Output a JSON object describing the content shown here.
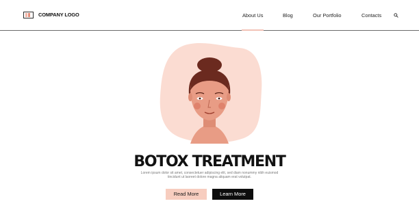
{
  "header": {
    "logo_text": "COMPANY LOGO",
    "nav": [
      {
        "label": "About Us",
        "active": true
      },
      {
        "label": "Blog"
      },
      {
        "label": "Our Portfolio"
      },
      {
        "label": "Contacts"
      }
    ],
    "search_icon": "search-icon"
  },
  "hero": {
    "title": "BOTOX TREATMENT",
    "description": "Lorem ipsum dolor sit amet, consectetuer adipiscing elit, sed diam nonummy nibh euismod tincidunt ut laoreet dolore magna aliquam erat volutpat.",
    "primary_button": "Read More",
    "secondary_button": "Learn More"
  },
  "colors": {
    "accent": "#f7cdbf",
    "accent_dark": "#e38e7b",
    "blob": "#fbdcd2",
    "skin": "#e89c85",
    "hair": "#6b2a1f",
    "dark_button": "#0d0d0d",
    "text": "#121212"
  }
}
